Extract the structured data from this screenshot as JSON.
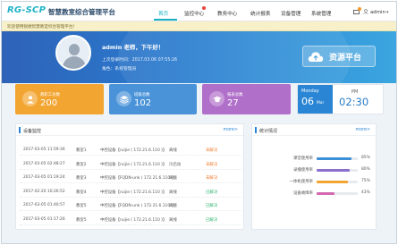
{
  "app": {
    "logo": "RG-SCP",
    "title": "智慧教室综合管理平台"
  },
  "nav": {
    "items": [
      {
        "label": "首页",
        "active": true
      },
      {
        "label": "监控中心",
        "active": false
      },
      {
        "label": "教务中心",
        "active": false
      },
      {
        "label": "统计报表",
        "active": false
      },
      {
        "label": "设备管理",
        "active": false
      },
      {
        "label": "系统管理",
        "active": false
      }
    ],
    "user_name": "admin",
    "user_caret": "▾",
    "mail_icon": "mail-icon",
    "user_icon": "user-icon"
  },
  "welcome": {
    "text": "欢迎使用锐捷智慧教室综合管理平台！"
  },
  "hero": {
    "greeting": "admin  老师，下午好！",
    "last_login": "上次登录时间：2017.03.06 07:55:26",
    "role": "角色：系统管理员",
    "cloud_button": "资源平台"
  },
  "cards": [
    {
      "label": "教职工总数",
      "value": "200",
      "icon": "person-icon",
      "color": "#f3a531"
    },
    {
      "label": "班级总数",
      "value": "102",
      "icon": "layers-icon",
      "color": "#4a93d9"
    },
    {
      "label": "报表总数",
      "value": "27",
      "icon": "graduation-cap-icon",
      "color": "#b06fc9"
    }
  ],
  "clock": {
    "weekday": "Monday",
    "day": "06",
    "month": "Mar",
    "period": "PM",
    "time": "02:30"
  },
  "device_panel": {
    "title": "设备监控",
    "more": "more>",
    "rows": [
      {
        "time": "2017-03-05 11:59:36",
        "room": "教室1",
        "device": "中控设备【ruijie ( 172.21.6.110 )】",
        "status": "离线",
        "result": "未解决",
        "resolved": false
      },
      {
        "time": "2017-03-05 02:48:27",
        "room": "教室2",
        "device": "中控设备【ruijie ( 172.21.6.110 )】",
        "status": "冷启动",
        "result": "未解决",
        "resolved": false
      },
      {
        "time": "2017-03-05 01:19:24",
        "room": "教室3",
        "device": "中控设备【FQDN-unk ( 172.21.6.110 )】",
        "status": "离线",
        "result": "未解决",
        "resolved": false
      },
      {
        "time": "2017-02-20 10:26:52",
        "room": "教室4",
        "device": "中控设备【ruijie ( 172.21.6.110 )】",
        "status": "离线",
        "result": "已解决",
        "resolved": true
      },
      {
        "time": "2017-03-05 01:40:57",
        "room": "教室5",
        "device": "中控设备【FQDN-unk ( 172.21.6.110 )】",
        "status": "离线",
        "result": "已解决",
        "resolved": true
      },
      {
        "time": "2017-03-05 01:17:26",
        "room": "教室5",
        "device": "中控设备【ruijie ( 172.21.6.110 )】",
        "status": "离线",
        "result": "已解决",
        "resolved": true
      }
    ]
  },
  "stats_panel": {
    "title": "统计情况",
    "more": "more>",
    "items": [
      {
        "label": "课堂使用率",
        "percent": 85,
        "display": "85%",
        "color": "#3d8fd8"
      },
      {
        "label": "录播使用率",
        "percent": 80,
        "display": "80%",
        "color": "#8b6fcf"
      },
      {
        "label": "一体机使用率",
        "percent": 75,
        "display": "75%",
        "color": "#f3a531"
      },
      {
        "label": "设备故障率",
        "percent": 43,
        "display": "43%",
        "color": "#d469b0"
      }
    ]
  }
}
